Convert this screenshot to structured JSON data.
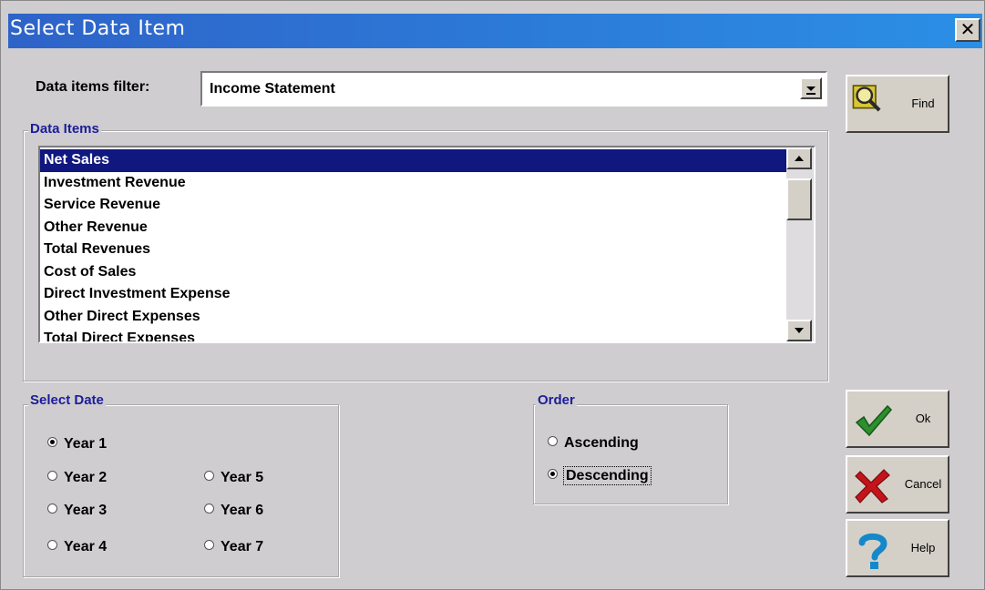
{
  "window": {
    "title": "Select Data Item",
    "close_glyph": "✕"
  },
  "filter": {
    "label": "Data items filter:",
    "value": "Income Statement"
  },
  "data_items": {
    "title": "Data Items",
    "items": [
      "Net Sales",
      "Investment Revenue",
      "Service Revenue",
      "Other Revenue",
      "Total Revenues",
      "Cost of Sales",
      "Direct Investment Expense",
      "Other Direct Expenses",
      "Total Direct Expenses"
    ],
    "selected": "Net Sales"
  },
  "select_date": {
    "title": "Select Date",
    "options": [
      "Year 1",
      "Year 2",
      "Year 3",
      "Year 4",
      "Year 5",
      "Year 6",
      "Year 7"
    ],
    "selected": "Year 1"
  },
  "order": {
    "title": "Order",
    "options": [
      "Ascending",
      "Descending"
    ],
    "selected": "Descending"
  },
  "buttons": {
    "find": {
      "label": "Find",
      "icon": "find-icon"
    },
    "ok": {
      "label": "Ok",
      "icon": "checkmark-icon"
    },
    "cancel": {
      "label": "Cancel",
      "icon": "x-icon"
    },
    "help": {
      "label": "Help",
      "icon": "question-icon"
    }
  },
  "colors": {
    "title_bar": "#2e63c8",
    "selection": "#10177e",
    "group_title": "#1b1d9a",
    "ok_check": "#2d8f2f",
    "cancel_x": "#c4141b",
    "help_q": "#1588c9"
  }
}
